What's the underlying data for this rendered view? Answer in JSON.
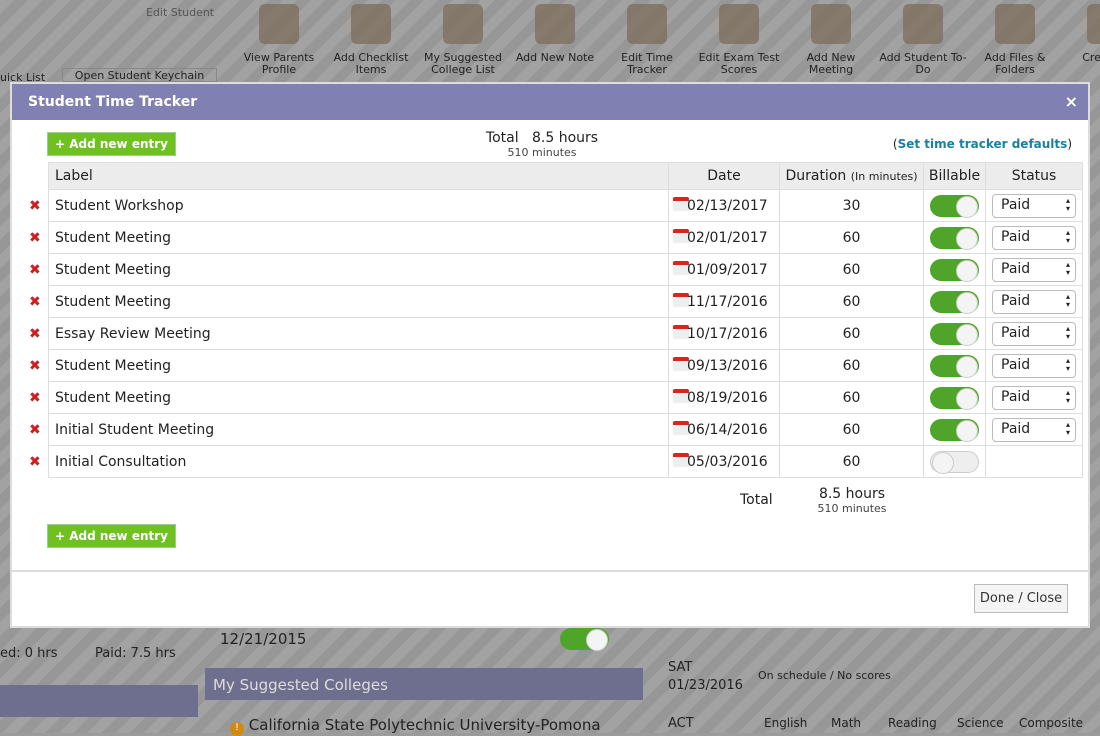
{
  "background": {
    "edit_student": "Edit Student",
    "toolbar": [
      {
        "label": "View Parents Profile",
        "icon": "parents-icon"
      },
      {
        "label": "Add Checklist Items",
        "icon": "notepad-icon"
      },
      {
        "label": "My Suggested College List",
        "icon": "college-icon"
      },
      {
        "label": "Add New Note",
        "icon": "note-icon"
      },
      {
        "label": "Edit Time Tracker",
        "icon": "stopwatch-icon"
      },
      {
        "label": "Edit Exam Test Scores",
        "icon": "exam-icon"
      },
      {
        "label": "Add New Meeting",
        "icon": "calendar-icon"
      },
      {
        "label": "Add Student To-Do",
        "icon": "clipboard-icon"
      },
      {
        "label": "Add Files & Folders",
        "icon": "folder-icon"
      },
      {
        "label": "Cre Colle",
        "icon": "create-icon"
      }
    ],
    "quick_list": "uick List",
    "keychain": "Open Student Keychain",
    "unbilled": "ed: 0 hrs",
    "paid": "Paid: 7.5 hrs",
    "meeting_date": "12/21/2015",
    "suggested_colleges": "My Suggested Colleges",
    "college": "California State Polytechnic University-Pomona",
    "score": "Score",
    "sat": "SAT",
    "sat_date": "01/23/2016",
    "sat_status": "On schedule / No scores",
    "act": "ACT",
    "act_cols": [
      "English",
      "Math",
      "Reading",
      "Science",
      "Composite"
    ]
  },
  "modal": {
    "title": "Student Time Tracker",
    "close": "×",
    "add_entry": "+ Add new entry",
    "total_label": "Total",
    "total_hours": "8.5 hours",
    "total_minutes": "510 minutes",
    "defaults_link": "Set time tracker defaults",
    "columns": [
      "Label",
      "Date",
      "Duration",
      "(In minutes)",
      "Billable",
      "Status"
    ],
    "rows": [
      {
        "label": "Student Workshop",
        "date": "02/13/2017",
        "duration": "30",
        "billable": true,
        "status": "Paid"
      },
      {
        "label": "Student Meeting",
        "date": "02/01/2017",
        "duration": "60",
        "billable": true,
        "status": "Paid"
      },
      {
        "label": "Student Meeting",
        "date": "01/09/2017",
        "duration": "60",
        "billable": true,
        "status": "Paid"
      },
      {
        "label": "Student Meeting",
        "date": "11/17/2016",
        "duration": "60",
        "billable": true,
        "status": "Paid"
      },
      {
        "label": "Essay Review Meeting",
        "date": "10/17/2016",
        "duration": "60",
        "billable": true,
        "status": "Paid"
      },
      {
        "label": "Student Meeting",
        "date": "09/13/2016",
        "duration": "60",
        "billable": true,
        "status": "Paid"
      },
      {
        "label": "Student Meeting",
        "date": "08/19/2016",
        "duration": "60",
        "billable": true,
        "status": "Paid"
      },
      {
        "label": "Initial Student Meeting",
        "date": "06/14/2016",
        "duration": "60",
        "billable": true,
        "status": "Paid"
      },
      {
        "label": "Initial Consultation",
        "date": "05/03/2016",
        "duration": "60",
        "billable": false,
        "status": ""
      }
    ],
    "footer_total_label": "Total",
    "footer_hours": "8.5 hours",
    "footer_minutes": "510 minutes",
    "done": "Done / Close"
  },
  "colors": {
    "header": "#8080b2",
    "add_button": "#6ec11e",
    "toggle_on": "#4ea52a",
    "delete": "#cc1f1f",
    "link": "#1b7fa3"
  }
}
